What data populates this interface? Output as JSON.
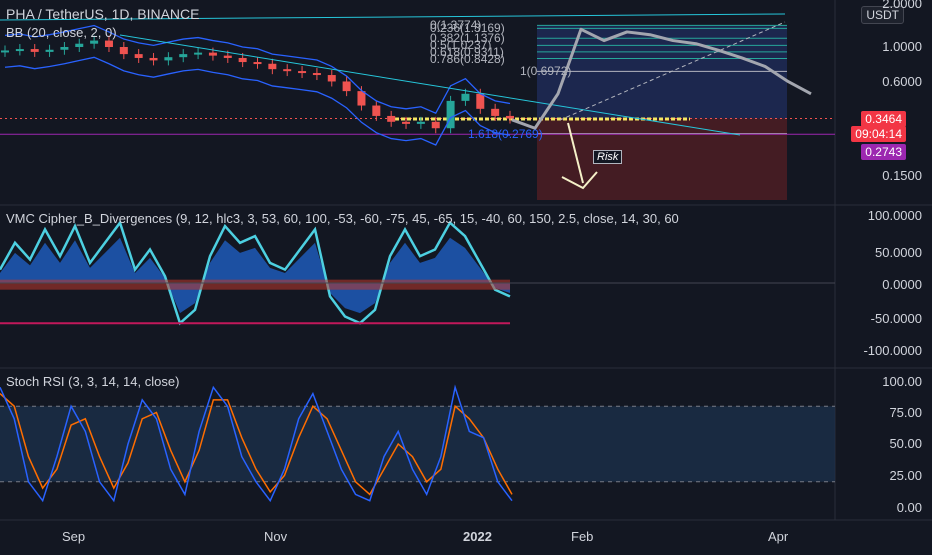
{
  "header": {
    "symbol": "PHA / TetherUS, 1D, BINANCE",
    "indicator_bb": "BB (20, close, 2, 0)",
    "currency_button": "USDT"
  },
  "price_axis": {
    "ticks": [
      "2.0000",
      "1.0000",
      "0.6000",
      "0.1500"
    ],
    "last_price": "0.3464",
    "countdown": "09:04:14",
    "level_price": "0.2743"
  },
  "fib_labels": [
    "0(1.3774)",
    "0.236(1.3169)",
    "0.382(1.1376)",
    "0.5(1.0237)",
    "0.618(0.9311)",
    "0.786(0.8428)",
    "1(0.6972)",
    "1.618(0.2769)"
  ],
  "risk_label": "Risk",
  "vmc": {
    "title": "VMC Cipher_B_Divergences (9, 12, hlc3, 3, 53, 60, 100, -53, -60, -75, 45, -65, 15, -40, 60, 150, 2.5, close, 14, 30, 60",
    "ticks": [
      "100.0000",
      "50.0000",
      "0.0000",
      "-50.0000",
      "-100.0000"
    ]
  },
  "stoch": {
    "title": "Stoch RSI (3, 3, 14, 14, close)",
    "ticks": [
      "100.00",
      "75.00",
      "50.00",
      "25.00",
      "0.00"
    ]
  },
  "time_axis": [
    "Sep",
    "Nov",
    "2022",
    "Feb",
    "Apr"
  ],
  "colors": {
    "background": "#131722",
    "bull": "#26a69a",
    "bear": "#ef5350",
    "bb_band": "#2962ff",
    "fib": "#b2b5be",
    "projection": "#a3a6af",
    "stoch_k": "#2962ff",
    "stoch_d": "#ff6d00",
    "vmc_wave": "#4dd0e1",
    "risk_zone": "#4a1d24",
    "reward_zone": "#1f2a56",
    "last_price_badge": "#f23645",
    "level_badge": "#9c27b0"
  },
  "chart_data": [
    {
      "type": "candlestick",
      "title": "PHA / TetherUS, 1D, BINANCE",
      "x": [
        "Sep",
        "Nov",
        "2022",
        "Feb",
        "Apr"
      ],
      "yscale": "log",
      "yticks": [
        2.0,
        1.0,
        0.6,
        0.15
      ],
      "closes": [
        0.95,
        0.97,
        0.93,
        0.96,
        1.0,
        1.05,
        1.1,
        1.0,
        0.9,
        0.85,
        0.82,
        0.86,
        0.9,
        0.92,
        0.88,
        0.85,
        0.8,
        0.78,
        0.72,
        0.7,
        0.68,
        0.66,
        0.6,
        0.52,
        0.42,
        0.36,
        0.33,
        0.32,
        0.33,
        0.3,
        0.45,
        0.5,
        0.4,
        0.36,
        0.3464
      ],
      "last_price": 0.3464,
      "level": 0.2743,
      "fib_levels": [
        {
          "ratio": 0,
          "price": 1.3774
        },
        {
          "ratio": 0.236,
          "price": 1.3169
        },
        {
          "ratio": 0.382,
          "price": 1.1376
        },
        {
          "ratio": 0.5,
          "price": 1.0237
        },
        {
          "ratio": 0.618,
          "price": 0.9311
        },
        {
          "ratio": 0.786,
          "price": 0.8428
        },
        {
          "ratio": 1,
          "price": 0.6972
        },
        {
          "ratio": 1.618,
          "price": 0.2769
        }
      ],
      "projection_path": [
        0.34,
        0.3,
        0.5,
        1.3,
        1.1,
        1.25,
        1.2,
        1.1,
        1.05,
        0.95,
        0.85,
        0.75,
        0.6,
        0.5
      ]
    },
    {
      "type": "line",
      "title": "VMC Cipher_B_Divergences",
      "ylim": [
        -100,
        100
      ],
      "yticks": [
        100,
        50,
        0,
        -50,
        -100
      ],
      "series": [
        {
          "values": [
            20,
            60,
            35,
            80,
            40,
            85,
            30,
            60,
            90,
            20,
            50,
            10,
            -60,
            -40,
            40,
            85,
            60,
            70,
            30,
            20,
            50,
            80,
            -20,
            -50,
            -60,
            -40,
            40,
            80,
            40,
            50,
            90,
            70,
            30,
            -10,
            -20
          ]
        }
      ]
    },
    {
      "type": "line",
      "title": "Stoch RSI (3, 3, 14, 14, close)",
      "ylim": [
        0,
        100
      ],
      "yticks": [
        100,
        75,
        50,
        25,
        0
      ],
      "series": [
        {
          "values": [
            95,
            70,
            20,
            5,
            40,
            80,
            60,
            20,
            5,
            50,
            85,
            70,
            30,
            10,
            60,
            95,
            80,
            40,
            20,
            5,
            30,
            70,
            90,
            60,
            30,
            10,
            5,
            40,
            60,
            30,
            10,
            40,
            95,
            60,
            55,
            20,
            5
          ]
        },
        {
          "values": [
            90,
            80,
            40,
            15,
            30,
            65,
            70,
            40,
            15,
            35,
            70,
            75,
            45,
            20,
            45,
            85,
            85,
            55,
            30,
            12,
            25,
            55,
            80,
            70,
            45,
            20,
            10,
            30,
            50,
            40,
            20,
            30,
            80,
            70,
            55,
            30,
            10
          ]
        }
      ]
    }
  ]
}
